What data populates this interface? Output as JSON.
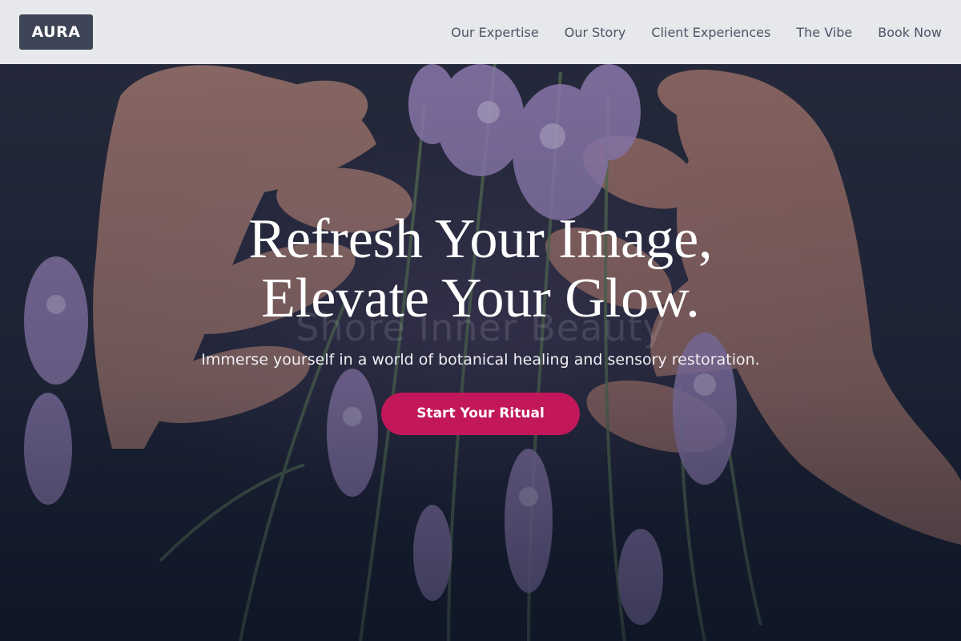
{
  "brand": {
    "logo": "AURA"
  },
  "nav": {
    "items": [
      {
        "label": "Our Expertise"
      },
      {
        "label": "Our Story"
      },
      {
        "label": "Client Experiences"
      },
      {
        "label": "The Vibe"
      },
      {
        "label": "Book Now"
      }
    ]
  },
  "hero": {
    "headline_line1": "Refresh Your Image,",
    "headline_line2": "Elevate Your Glow.",
    "watermark": "Shore Inner Beauty",
    "subtext": "Immerse yourself in a world of botanical healing and sensory restoration.",
    "cta_label": "Start Your Ritual",
    "cta_color": "#c2185b"
  },
  "colors": {
    "nav_bg": "#f1f2f4",
    "logo_bg": "#3d4455",
    "nav_text": "#4b5466",
    "hero_overlay": "#1a2233"
  }
}
